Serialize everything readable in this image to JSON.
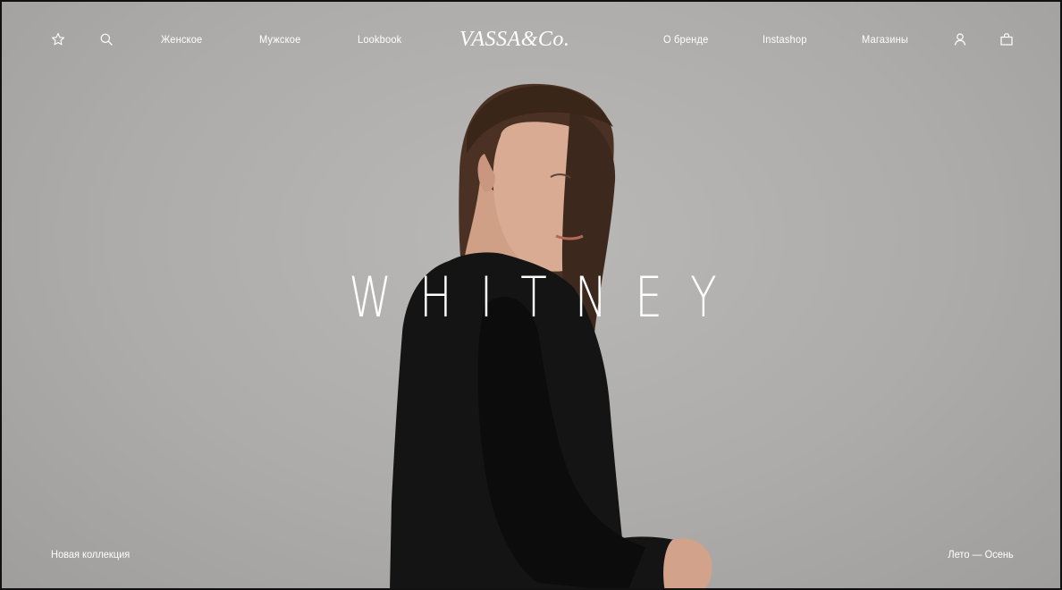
{
  "nav": {
    "favorites_icon": "star-icon",
    "search_icon": "search-icon",
    "links": [
      "Женское",
      "Мужское",
      "Lookbook",
      "О бренде",
      "Instashop",
      "Магазины"
    ],
    "logo": "VASSA&Co.",
    "account_icon": "user-icon",
    "cart_icon": "bag-icon"
  },
  "hero": {
    "title": "WHITNEY",
    "caption_left": "Новая коллекция",
    "caption_right": "Лето — Осень"
  },
  "colors": {
    "background": "#adacaa",
    "text": "#ffffff",
    "garment": "#141414",
    "hair": "#4a3124",
    "skin": "#d8ab92"
  }
}
